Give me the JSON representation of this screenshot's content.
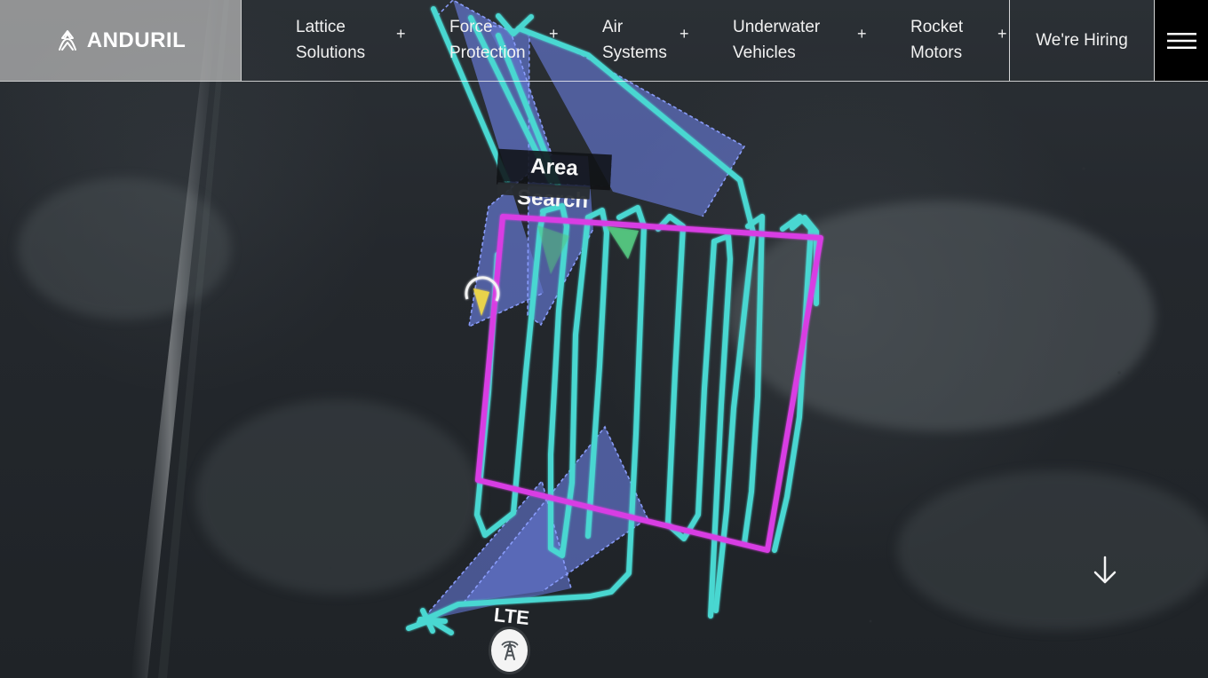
{
  "brand": {
    "name": "ANDURIL",
    "logo_icon": "anduril-logo-icon"
  },
  "nav": {
    "items": [
      {
        "line1": "Lattice",
        "line2": "Solutions",
        "expand": "+"
      },
      {
        "line1": "Force",
        "line2": "Protection",
        "expand": "+"
      },
      {
        "line1": "Air",
        "line2": "Systems",
        "expand": "+"
      },
      {
        "line1": "Underwater",
        "line2": "Vehicles",
        "expand": "+"
      },
      {
        "line1": "Rocket",
        "line2": "Motors",
        "expand": "+"
      }
    ],
    "hiring_label": "We're Hiring",
    "menu_icon": "hamburger-menu-icon"
  },
  "hero": {
    "overlay_label": "Area Search",
    "lte_label": "LTE",
    "scroll_icon": "arrow-down-icon",
    "colors": {
      "path": "#4ad7d1",
      "zone": "#6d83ea",
      "boundary": "#d83ee3",
      "marker": "#e8d34b",
      "marker_green": "#54c47f"
    }
  }
}
